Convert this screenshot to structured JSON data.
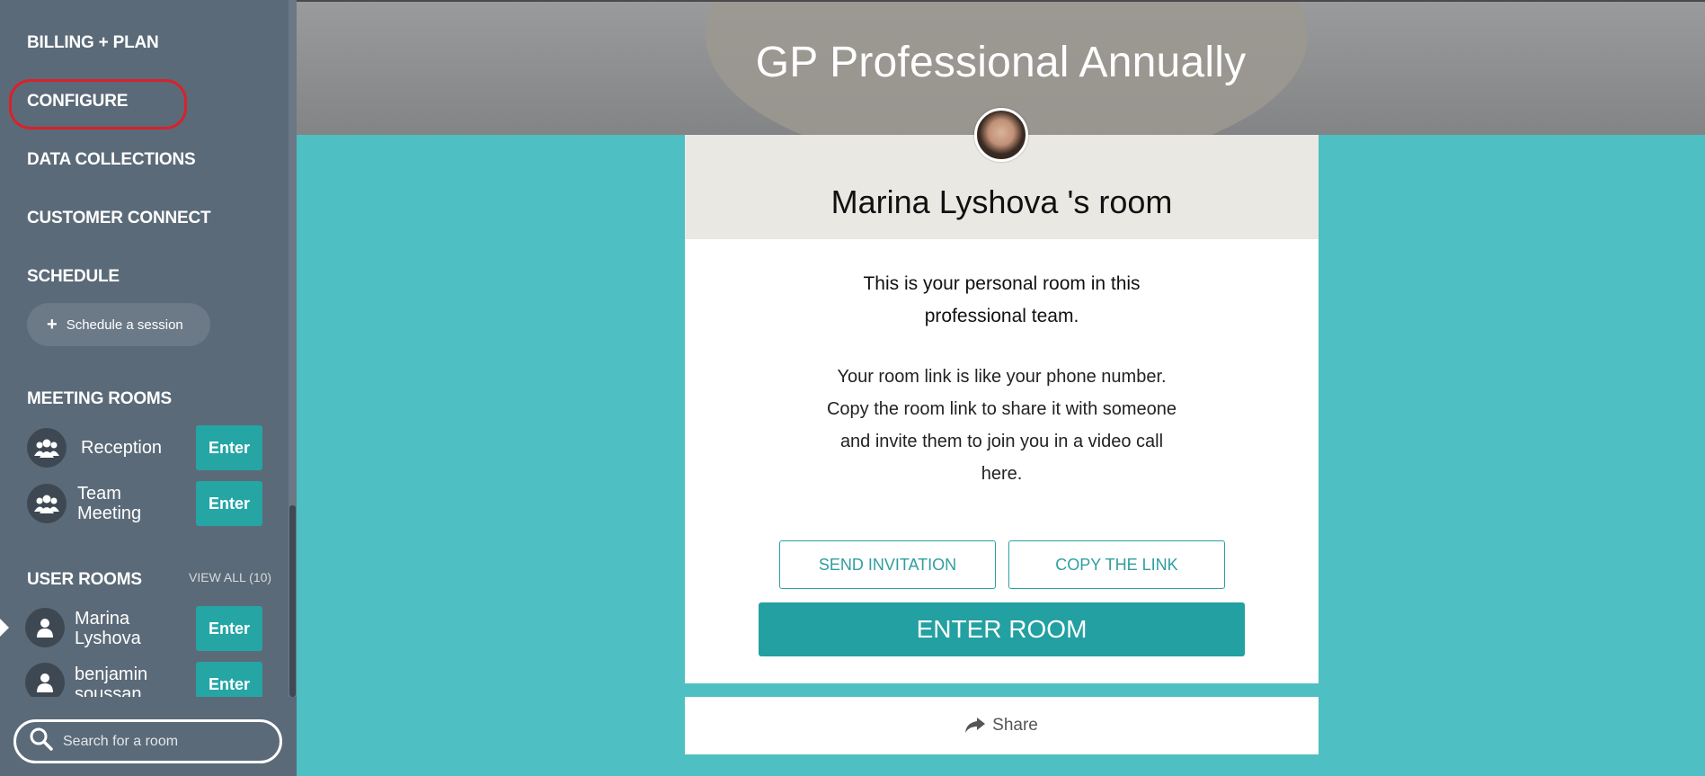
{
  "sidebar": {
    "nav": {
      "billing": "BILLING + PLAN",
      "configure": "CONFIGURE",
      "data_collections": "DATA COLLECTIONS",
      "customer_connect": "CUSTOMER CONNECT",
      "schedule": "SCHEDULE"
    },
    "schedule_button": "Schedule a session",
    "meeting_rooms": {
      "title": "MEETING ROOMS",
      "rooms": [
        {
          "name": "Reception",
          "action": "Enter",
          "icon": "group-icon"
        },
        {
          "name": "Team Meeting",
          "action": "Enter",
          "icon": "group-icon"
        }
      ]
    },
    "user_rooms": {
      "title": "USER ROOMS",
      "view_all": "VIEW ALL (10)",
      "rooms": [
        {
          "name": "Marina Lyshova",
          "action": "Enter",
          "icon": "user-icon"
        },
        {
          "name": "benjamin soussan",
          "action": "Enter",
          "icon": "user-icon"
        }
      ]
    },
    "search": {
      "placeholder": "Search for a room",
      "icon": "search-icon"
    }
  },
  "header": {
    "title": "GP Professional Annually"
  },
  "card": {
    "room_title": "Marina Lyshova 's room",
    "intro_line1": "This is your personal room in this",
    "intro_line2": "professional team.",
    "desc_line1": "Your room link is like your phone number.",
    "desc_line2": "Copy the room link to share it with someone",
    "desc_line3": "and invite them to join you in a video call",
    "desc_line4": "here.",
    "send_invitation": "SEND INVITATION",
    "copy_link": "COPY THE LINK",
    "enter_room": "ENTER ROOM"
  },
  "share": {
    "label": "Share",
    "icon": "share-icon"
  },
  "colors": {
    "sidebar": "#5b6a78",
    "teal": "#4ec0c3",
    "button_teal": "#26a5a5",
    "highlight_ring": "#d9212c"
  }
}
